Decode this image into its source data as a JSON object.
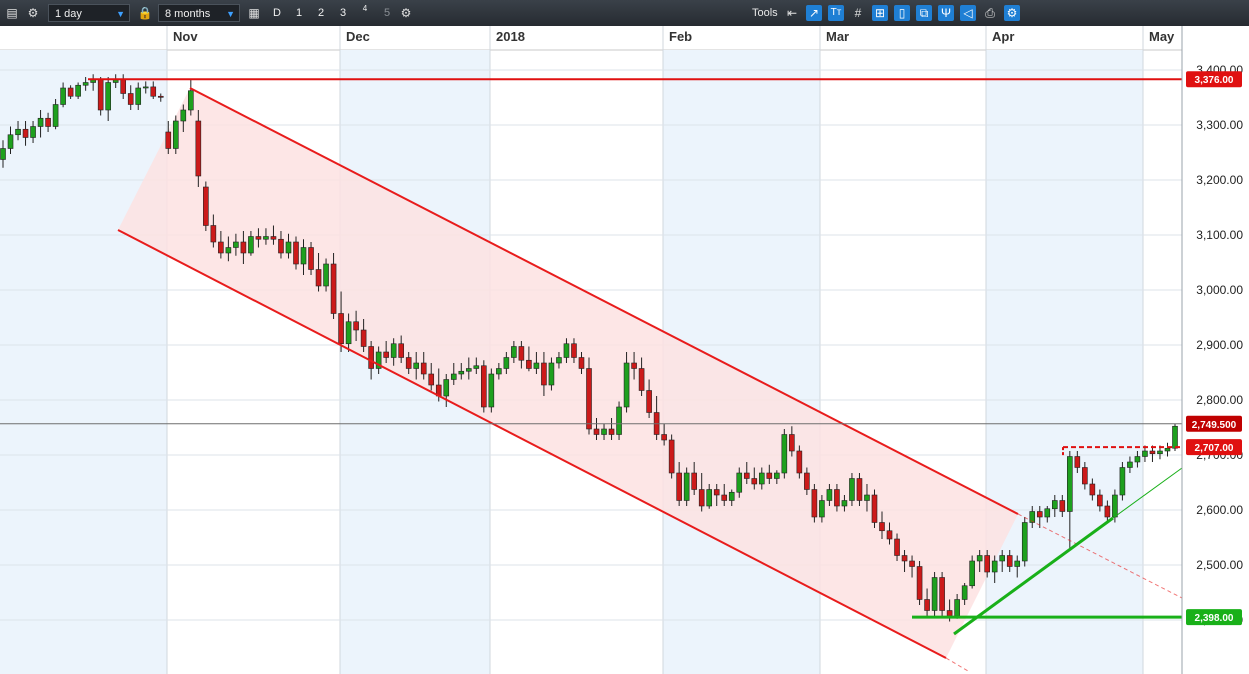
{
  "toolbar": {
    "interval": "1 day",
    "range": "8 months",
    "period_buttons": [
      "D",
      "1",
      "2",
      "3",
      "4",
      "5"
    ],
    "tools_label": "Tools",
    "icons": [
      "menu-icon",
      "settings-icon",
      "lock-icon",
      "calendar-icon",
      "compare-icon",
      "settings-icon",
      "back-arrow-icon",
      "trendline-icon",
      "text-icon",
      "grid-icon",
      "fibonacci-icon",
      "candle-icon",
      "copy-icon",
      "pitchfork-icon",
      "shape-icon",
      "print-icon",
      "settings-gear-icon"
    ],
    "accent": "#1f7fd4"
  },
  "chart_data": {
    "type": "candlestick",
    "months": [
      "Nov",
      "Dec",
      "2018",
      "Feb",
      "Mar",
      "Apr",
      "May"
    ],
    "y_ticks": [
      "3,400.00",
      "3,300.00",
      "3,200.00",
      "3,100.00",
      "3,000.00",
      "2,900.00",
      "2,800.00",
      "2,700.00",
      "2,600.00",
      "2,500.00",
      "2,400.00"
    ],
    "ylim": [
      2400,
      3400
    ],
    "levels": [
      {
        "label": "3,376.00",
        "value": 3376,
        "color": "#e01010",
        "style": "solid"
      },
      {
        "label": "2,749.500",
        "value": 2749.5,
        "color": "#c00000",
        "style": "crosshair"
      },
      {
        "label": "2,707.00",
        "value": 2707,
        "color": "#e01010",
        "style": "dashed"
      },
      {
        "label": "2,398.00",
        "value": 2398,
        "color": "#19b019",
        "style": "solid"
      }
    ],
    "colors": {
      "up": "#1ea01e",
      "down": "#cc1a1a",
      "channel": "#e81c1c",
      "support": "#19b019",
      "shade": "#fde2e2"
    },
    "candles_ohlc": [
      [
        3230,
        3265,
        3215,
        3250
      ],
      [
        3250,
        3290,
        3240,
        3275
      ],
      [
        3275,
        3300,
        3265,
        3285
      ],
      [
        3285,
        3300,
        3255,
        3270
      ],
      [
        3270,
        3300,
        3260,
        3290
      ],
      [
        3290,
        3320,
        3270,
        3305
      ],
      [
        3305,
        3315,
        3280,
        3290
      ],
      [
        3290,
        3340,
        3285,
        3330
      ],
      [
        3330,
        3370,
        3325,
        3360
      ],
      [
        3360,
        3365,
        3340,
        3345
      ],
      [
        3345,
        3370,
        3340,
        3365
      ],
      [
        3365,
        3380,
        3355,
        3370
      ],
      [
        3370,
        3385,
        3355,
        3375
      ],
      [
        3375,
        3380,
        3310,
        3320
      ],
      [
        3320,
        3380,
        3300,
        3370
      ],
      [
        3370,
        3385,
        3360,
        3375
      ],
      [
        3375,
        3385,
        3340,
        3350
      ],
      [
        3350,
        3365,
        3320,
        3330
      ],
      [
        3330,
        3370,
        3320,
        3360
      ],
      [
        3360,
        3372,
        3350,
        3362
      ],
      [
        3362,
        3372,
        3340,
        3345
      ],
      [
        3345,
        3350,
        3335,
        3343
      ],
      [
        3280,
        3300,
        3240,
        3250
      ],
      [
        3250,
        3310,
        3240,
        3300
      ],
      [
        3300,
        3330,
        3280,
        3320
      ],
      [
        3320,
        3375,
        3310,
        3355
      ],
      [
        3300,
        3320,
        3180,
        3200
      ],
      [
        3180,
        3190,
        3100,
        3110
      ],
      [
        3110,
        3130,
        3070,
        3080
      ],
      [
        3080,
        3100,
        3050,
        3060
      ],
      [
        3060,
        3090,
        3045,
        3070
      ],
      [
        3070,
        3095,
        3055,
        3080
      ],
      [
        3080,
        3100,
        3040,
        3060
      ],
      [
        3060,
        3100,
        3055,
        3090
      ],
      [
        3090,
        3105,
        3070,
        3085
      ],
      [
        3085,
        3105,
        3075,
        3090
      ],
      [
        3090,
        3110,
        3075,
        3085
      ],
      [
        3085,
        3100,
        3050,
        3060
      ],
      [
        3060,
        3095,
        3050,
        3080
      ],
      [
        3080,
        3090,
        3030,
        3040
      ],
      [
        3040,
        3085,
        3020,
        3070
      ],
      [
        3070,
        3080,
        3020,
        3030
      ],
      [
        3030,
        3060,
        2990,
        3000
      ],
      [
        3000,
        3050,
        2990,
        3040
      ],
      [
        3040,
        3060,
        2940,
        2950
      ],
      [
        2950,
        2990,
        2880,
        2895
      ],
      [
        2895,
        2950,
        2880,
        2935
      ],
      [
        2935,
        2955,
        2900,
        2920
      ],
      [
        2920,
        2940,
        2880,
        2890
      ],
      [
        2890,
        2900,
        2830,
        2850
      ],
      [
        2850,
        2890,
        2840,
        2880
      ],
      [
        2880,
        2900,
        2860,
        2870
      ],
      [
        2870,
        2905,
        2855,
        2895
      ],
      [
        2895,
        2910,
        2860,
        2870
      ],
      [
        2870,
        2880,
        2840,
        2850
      ],
      [
        2850,
        2880,
        2830,
        2860
      ],
      [
        2860,
        2880,
        2830,
        2840
      ],
      [
        2840,
        2860,
        2810,
        2820
      ],
      [
        2820,
        2850,
        2790,
        2800
      ],
      [
        2800,
        2840,
        2780,
        2830
      ],
      [
        2830,
        2860,
        2820,
        2840
      ],
      [
        2840,
        2860,
        2830,
        2845
      ],
      [
        2845,
        2870,
        2830,
        2850
      ],
      [
        2850,
        2870,
        2840,
        2855
      ],
      [
        2855,
        2865,
        2770,
        2780
      ],
      [
        2780,
        2850,
        2770,
        2840
      ],
      [
        2840,
        2860,
        2830,
        2850
      ],
      [
        2850,
        2880,
        2840,
        2870
      ],
      [
        2870,
        2900,
        2860,
        2890
      ],
      [
        2890,
        2900,
        2850,
        2865
      ],
      [
        2865,
        2890,
        2845,
        2850
      ],
      [
        2850,
        2880,
        2840,
        2860
      ],
      [
        2860,
        2880,
        2800,
        2820
      ],
      [
        2820,
        2870,
        2810,
        2860
      ],
      [
        2860,
        2880,
        2850,
        2870
      ],
      [
        2870,
        2905,
        2860,
        2895
      ],
      [
        2895,
        2905,
        2860,
        2870
      ],
      [
        2870,
        2880,
        2840,
        2850
      ],
      [
        2850,
        2870,
        2730,
        2740
      ],
      [
        2740,
        2760,
        2720,
        2730
      ],
      [
        2730,
        2750,
        2720,
        2740
      ],
      [
        2740,
        2760,
        2720,
        2730
      ],
      [
        2730,
        2790,
        2720,
        2780
      ],
      [
        2780,
        2880,
        2770,
        2860
      ],
      [
        2860,
        2880,
        2830,
        2850
      ],
      [
        2850,
        2870,
        2800,
        2810
      ],
      [
        2810,
        2830,
        2760,
        2770
      ],
      [
        2770,
        2800,
        2720,
        2730
      ],
      [
        2730,
        2750,
        2710,
        2720
      ],
      [
        2720,
        2730,
        2650,
        2660
      ],
      [
        2660,
        2680,
        2600,
        2610
      ],
      [
        2610,
        2670,
        2600,
        2660
      ],
      [
        2660,
        2680,
        2620,
        2630
      ],
      [
        2630,
        2660,
        2590,
        2600
      ],
      [
        2600,
        2640,
        2595,
        2630
      ],
      [
        2630,
        2640,
        2600,
        2620
      ],
      [
        2620,
        2640,
        2600,
        2610
      ],
      [
        2610,
        2630,
        2600,
        2625
      ],
      [
        2625,
        2670,
        2615,
        2660
      ],
      [
        2660,
        2680,
        2640,
        2650
      ],
      [
        2650,
        2670,
        2630,
        2640
      ],
      [
        2640,
        2670,
        2630,
        2660
      ],
      [
        2660,
        2675,
        2640,
        2650
      ],
      [
        2650,
        2665,
        2640,
        2660
      ],
      [
        2660,
        2740,
        2650,
        2730
      ],
      [
        2730,
        2745,
        2690,
        2700
      ],
      [
        2700,
        2710,
        2650,
        2660
      ],
      [
        2660,
        2670,
        2620,
        2630
      ],
      [
        2630,
        2640,
        2570,
        2580
      ],
      [
        2580,
        2620,
        2570,
        2610
      ],
      [
        2610,
        2640,
        2600,
        2630
      ],
      [
        2630,
        2640,
        2590,
        2600
      ],
      [
        2600,
        2620,
        2590,
        2610
      ],
      [
        2610,
        2660,
        2600,
        2650
      ],
      [
        2650,
        2660,
        2600,
        2610
      ],
      [
        2610,
        2640,
        2590,
        2620
      ],
      [
        2620,
        2630,
        2560,
        2570
      ],
      [
        2570,
        2590,
        2540,
        2555
      ],
      [
        2555,
        2570,
        2530,
        2540
      ],
      [
        2540,
        2550,
        2500,
        2510
      ],
      [
        2510,
        2520,
        2480,
        2500
      ],
      [
        2500,
        2510,
        2470,
        2490
      ],
      [
        2490,
        2500,
        2420,
        2430
      ],
      [
        2430,
        2450,
        2400,
        2410
      ],
      [
        2410,
        2480,
        2400,
        2470
      ],
      [
        2470,
        2480,
        2400,
        2410
      ],
      [
        2410,
        2430,
        2390,
        2400
      ],
      [
        2400,
        2440,
        2395,
        2430
      ],
      [
        2430,
        2460,
        2420,
        2455
      ],
      [
        2455,
        2510,
        2450,
        2500
      ],
      [
        2500,
        2520,
        2480,
        2510
      ],
      [
        2510,
        2520,
        2470,
        2480
      ],
      [
        2480,
        2510,
        2460,
        2500
      ],
      [
        2500,
        2520,
        2480,
        2510
      ],
      [
        2510,
        2520,
        2480,
        2490
      ],
      [
        2490,
        2510,
        2470,
        2500
      ],
      [
        2500,
        2580,
        2490,
        2570
      ],
      [
        2570,
        2600,
        2560,
        2590
      ],
      [
        2590,
        2600,
        2560,
        2580
      ],
      [
        2580,
        2600,
        2570,
        2595
      ],
      [
        2595,
        2620,
        2580,
        2610
      ],
      [
        2610,
        2620,
        2580,
        2590
      ],
      [
        2590,
        2700,
        2520,
        2690
      ],
      [
        2690,
        2700,
        2660,
        2670
      ],
      [
        2670,
        2680,
        2630,
        2640
      ],
      [
        2640,
        2650,
        2610,
        2620
      ],
      [
        2620,
        2630,
        2590,
        2600
      ],
      [
        2600,
        2610,
        2570,
        2580
      ],
      [
        2580,
        2630,
        2570,
        2620
      ],
      [
        2620,
        2680,
        2610,
        2670
      ],
      [
        2670,
        2690,
        2660,
        2680
      ],
      [
        2680,
        2700,
        2670,
        2690
      ],
      [
        2690,
        2710,
        2680,
        2700
      ],
      [
        2700,
        2710,
        2680,
        2695
      ],
      [
        2695,
        2710,
        2685,
        2700
      ],
      [
        2700,
        2715,
        2690,
        2705
      ],
      [
        2705,
        2750,
        2700,
        2745
      ]
    ]
  }
}
